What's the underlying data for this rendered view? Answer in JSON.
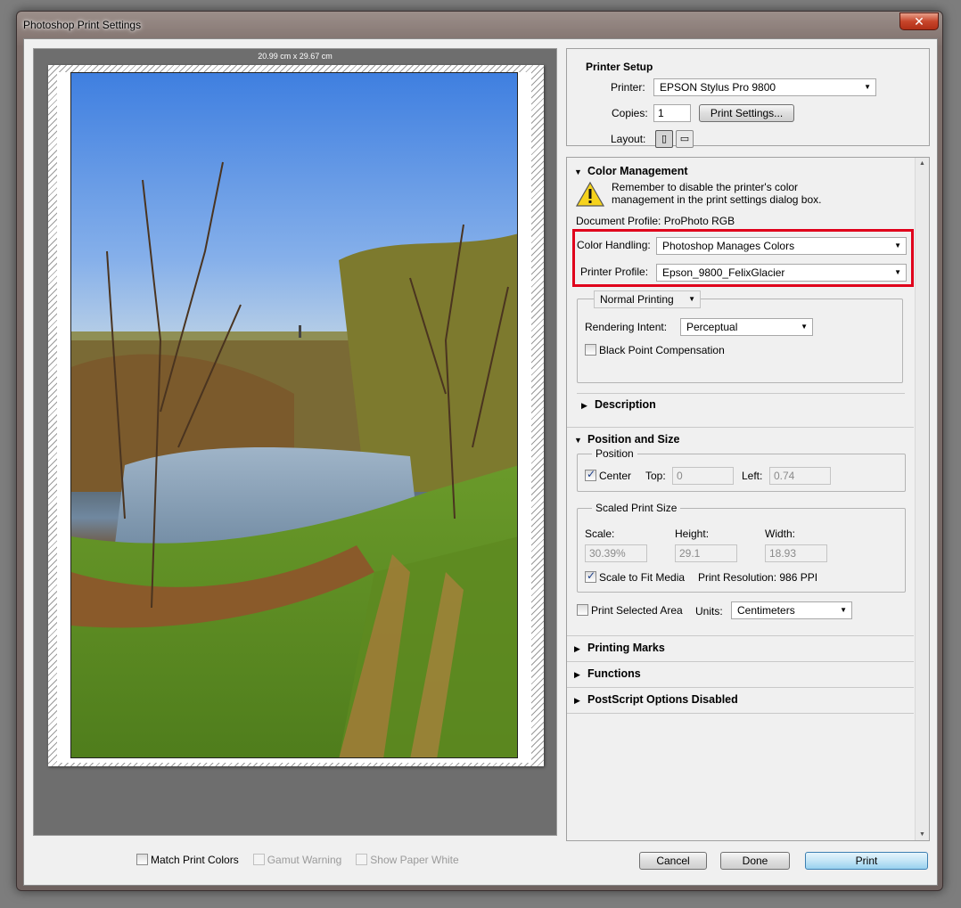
{
  "window": {
    "title": "Photoshop Print Settings",
    "close_glyph": "✕"
  },
  "preview": {
    "dimensions": "20.99 cm x 29.67 cm",
    "match_print_colors": {
      "label": "Match Print Colors",
      "checked": false
    },
    "gamut_warning": {
      "label": "Gamut Warning",
      "checked": false,
      "enabled": false
    },
    "show_paper_white": {
      "label": "Show Paper White",
      "checked": false,
      "enabled": false
    }
  },
  "printer_setup": {
    "heading": "Printer Setup",
    "printer_label": "Printer:",
    "printer_value": "EPSON Stylus Pro 9800",
    "copies_label": "Copies:",
    "copies_value": "1",
    "print_settings_button": "Print Settings...",
    "layout_label": "Layout:"
  },
  "color_management": {
    "heading": "Color Management",
    "warning_line1": "Remember to disable the printer's color",
    "warning_line2": "management in the print settings dialog box.",
    "document_profile": "Document Profile: ProPhoto RGB",
    "color_handling_label": "Color Handling:",
    "color_handling_value": "Photoshop Manages Colors",
    "printer_profile_label": "Printer Profile:",
    "printer_profile_value": "Epson_9800_FelixGlacier",
    "printing_mode": "Normal Printing",
    "rendering_intent_label": "Rendering Intent:",
    "rendering_intent_value": "Perceptual",
    "black_point_label": "Black Point Compensation",
    "black_point_checked": false,
    "description_heading": "Description"
  },
  "position_size": {
    "heading": "Position and Size",
    "position_group": "Position",
    "center_label": "Center",
    "center_checked": true,
    "top_label": "Top:",
    "top_value": "0",
    "left_label": "Left:",
    "left_value": "0.74",
    "scaled_group": "Scaled Print Size",
    "scale_label": "Scale:",
    "scale_value": "30.39%",
    "height_label": "Height:",
    "height_value": "29.1",
    "width_label": "Width:",
    "width_value": "18.93",
    "scale_to_fit_label": "Scale to Fit Media",
    "scale_to_fit_checked": true,
    "print_resolution": "Print Resolution: 986 PPI",
    "print_selected_label": "Print Selected Area",
    "print_selected_checked": false,
    "units_label": "Units:",
    "units_value": "Centimeters"
  },
  "collapsed_sections": {
    "printing_marks": "Printing Marks",
    "functions": "Functions",
    "postscript": "PostScript Options Disabled"
  },
  "buttons": {
    "cancel": "Cancel",
    "done": "Done",
    "print": "Print"
  },
  "colors": {
    "highlight_box": "#e0001b",
    "print_button": "#98d1ef"
  }
}
